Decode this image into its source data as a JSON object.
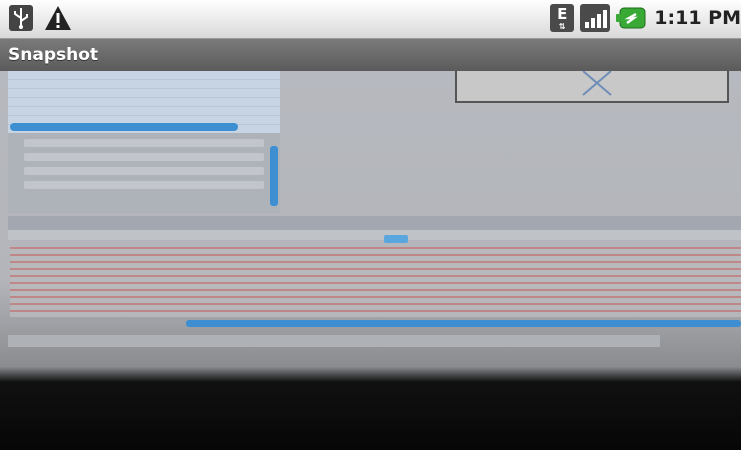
{
  "status_bar": {
    "icons": [
      "usb-icon",
      "warning-icon",
      "network-edge-icon",
      "signal-icon",
      "battery-charging-icon"
    ],
    "network_type": "E",
    "time": "1:11 PM",
    "colors": {
      "battery": "#39a935",
      "background": "#e6e6e6"
    }
  },
  "title_bar": {
    "title": "Snapshot",
    "background": "#666666"
  },
  "photo": {
    "description_icon": "camera-snapshot"
  }
}
